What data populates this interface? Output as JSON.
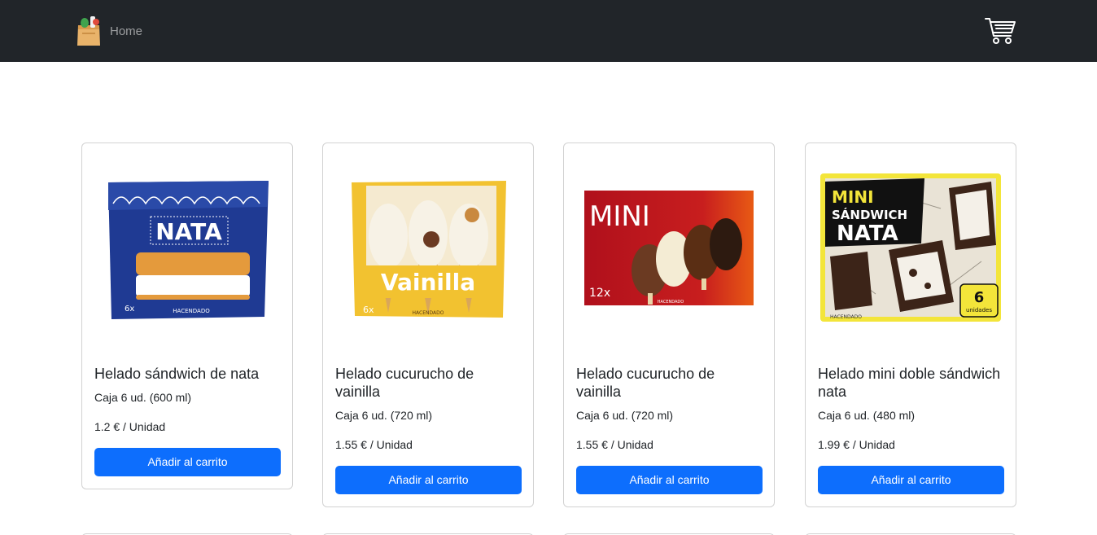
{
  "navbar": {
    "home_label": "Home",
    "logo_icon": "grocery-bag-icon",
    "cart_icon": "shopping-cart-icon",
    "background": "#212529"
  },
  "products": [
    {
      "title": "Helado sándwich de nata",
      "package": "Caja 6 ud. (600 ml)",
      "price": "1.2 € / Unidad",
      "button_label": "Añadir al carrito",
      "image": {
        "headline": "NATA",
        "count": "6x",
        "brand": "HACENDADO"
      }
    },
    {
      "title": "Helado cucurucho de vainilla",
      "package": "Caja 6 ud. (720 ml)",
      "price": "1.55 € / Unidad",
      "button_label": "Añadir al carrito",
      "image": {
        "headline": "Vainilla",
        "count": "6x",
        "brand": "HACENDADO"
      }
    },
    {
      "title": "Helado cucurucho de vainilla",
      "package": "Caja 6 ud. (720 ml)",
      "price": "1.55 € / Unidad",
      "button_label": "Añadir al carrito",
      "image": {
        "headline": "MINI",
        "count": "12x",
        "brand": "HACENDADO"
      }
    },
    {
      "title": "Helado mini doble sándwich nata",
      "package": "Caja 6 ud. (480 ml)",
      "price": "1.99 € / Unidad",
      "button_label": "Añadir al carrito",
      "image": {
        "headline_line1": "MINI",
        "headline_line2": "SÁNDWICH",
        "headline_line3": "NATA",
        "count": "6",
        "count_label": "unidades",
        "brand": "HACENDADO"
      }
    }
  ],
  "colors": {
    "primary": "#0d6efd",
    "navbar": "#212529"
  }
}
